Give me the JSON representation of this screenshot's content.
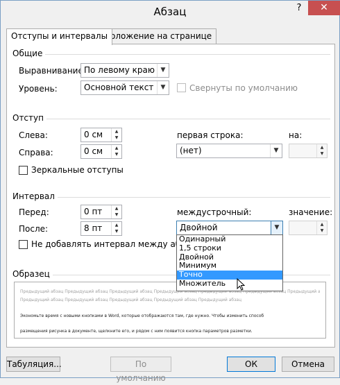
{
  "window": {
    "title": "Абзац",
    "help": "?",
    "close": "✕"
  },
  "tabs": [
    {
      "label": "Отступы и интервалы",
      "active": true
    },
    {
      "label": "Положение на странице",
      "active": false
    }
  ],
  "general": {
    "section": "Общие",
    "alignment_label": "Выравнивание:",
    "alignment_value": "По левому краю",
    "level_label": "Уровень:",
    "level_value": "Основной текст",
    "collapsed_label": "Свернуты по умолчанию"
  },
  "indent": {
    "section": "Отступ",
    "left_label": "Слева:",
    "left_value": "0 см",
    "right_label": "Справа:",
    "right_value": "0 см",
    "first_line_label": "первая строка:",
    "first_line_value": "(нет)",
    "by_label": "на:",
    "by_value": "",
    "mirror_label": "Зеркальные отступы"
  },
  "spacing": {
    "section": "Интервал",
    "before_label": "Перед:",
    "before_value": "0 пт",
    "after_label": "После:",
    "after_value": "8 пт",
    "line_label": "междустрочный:",
    "line_value": "Двойной",
    "at_label": "значение:",
    "at_value": "",
    "no_space_label": "Не добавлять интервал между абзацам"
  },
  "line_spacing_options": [
    "Одинарный",
    "1,5 строки",
    "Двойной",
    "Минимум",
    "Точно",
    "Множитель"
  ],
  "line_spacing_highlighted": "Точно",
  "preview": {
    "section": "Образец",
    "prev_line": "Предыдущий абзац Предыдущий абзац Предыдущий абзац Предыдущий абзац Предыдущий абзац Предыдущий абзац Предыдущий абзац",
    "prev_line2": "Предыдущий абзац Предыдущий абзац Предыдущий абзац Предыдущий абзац Предыдущий абзац",
    "sample_line1": "Экономьте время с новыми кнопками в Word, которые отображаются там, где нужно. Чтобы изменить способ",
    "sample_line2": "размещения рисунка в документе, щелкните его, и рядом с ним появится кнопка параметров разметки."
  },
  "buttons": {
    "tabs": "Табуляция...",
    "default": "По умолчанию",
    "ok": "ОК",
    "cancel": "Отмена"
  }
}
